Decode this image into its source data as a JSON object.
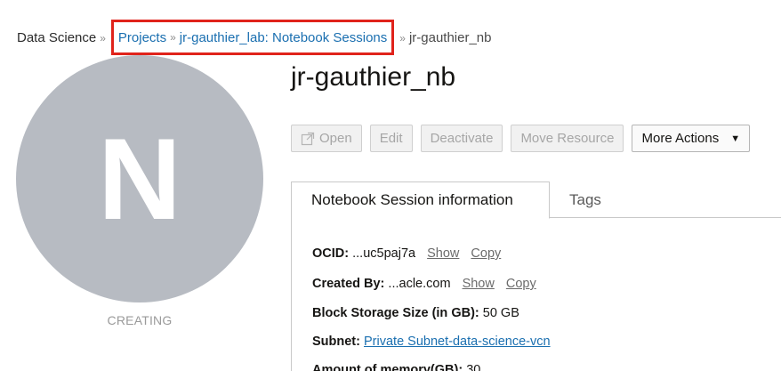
{
  "breadcrumb": {
    "root": "Data Science",
    "separator": "»",
    "projects": "Projects",
    "project_sessions": "jr-gauthier_lab: Notebook Sessions",
    "current": "jr-gauthier_nb"
  },
  "avatar": {
    "letter": "N",
    "color": "#b7bbc2"
  },
  "status": "CREATING",
  "title": "jr-gauthier_nb",
  "toolbar": {
    "open": "Open",
    "open_icon": "external-link-icon",
    "edit": "Edit",
    "deactivate": "Deactivate",
    "move_resource": "Move Resource",
    "more_actions": "More Actions",
    "caret": "▼"
  },
  "tabs": {
    "info": "Notebook Session information",
    "tags": "Tags"
  },
  "info": {
    "ocid_label": "OCID:",
    "ocid_value": "...uc5paj7a",
    "created_by_label": "Created By:",
    "created_by_value": "...acle.com",
    "show": "Show",
    "copy": "Copy",
    "storage_label": "Block Storage Size (in GB):",
    "storage_value": "50 GB",
    "subnet_label": "Subnet:",
    "subnet_value": "Private Subnet-data-science-vcn",
    "memory_label": "Amount of memory(GB):",
    "memory_value": "30"
  },
  "colors": {
    "link": "#1a6fb0",
    "highlight_border": "#e0231b"
  }
}
